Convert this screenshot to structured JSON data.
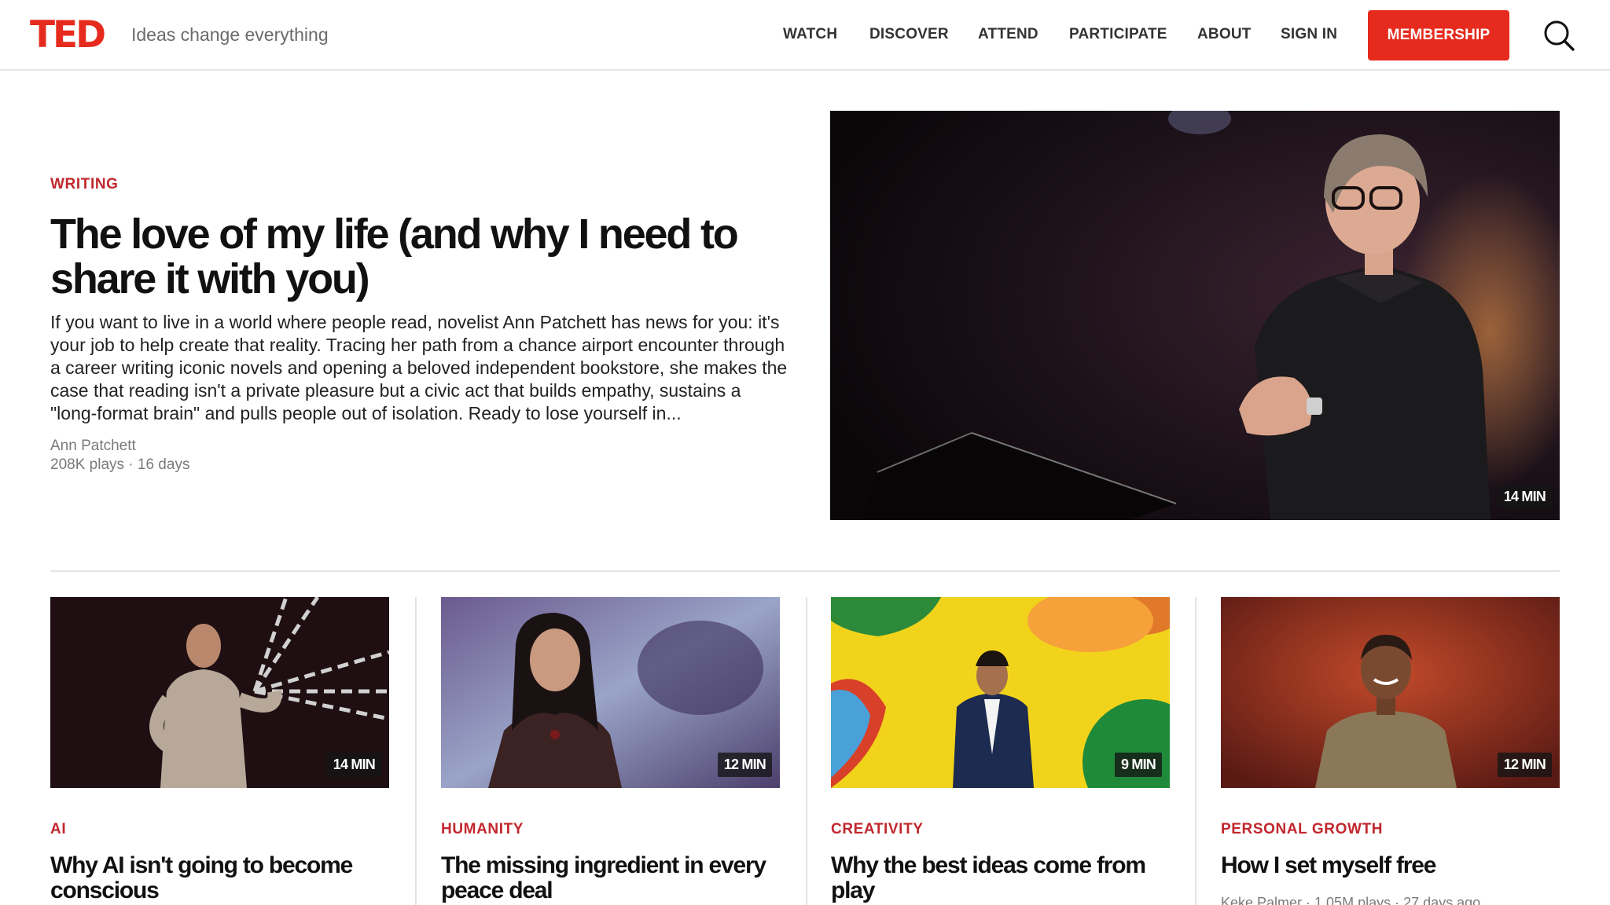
{
  "header": {
    "logo": "TED",
    "tagline": "Ideas change everything",
    "nav": [
      "WATCH",
      "DISCOVER",
      "ATTEND",
      "PARTICIPATE",
      "ABOUT",
      "SIGN IN"
    ],
    "membership_label": "MEMBERSHIP",
    "search_icon": "search-icon"
  },
  "hero": {
    "topic": "WRITING",
    "title": "The love of my life (and why I need to share it with you)",
    "description": "If you want to live in a world where people read, novelist Ann Patchett has news for you: it's your job to help create that reality. Tracing her path from a chance airport encounter through a career writing iconic novels and opening a beloved independent bookstore, she makes the case that reading isn't a private pleasure but a civic act that builds empathy, sustains a \"long-format brain\" and pulls people out of isolation. Ready to lose yourself in...",
    "speaker": "Ann Patchett",
    "meta": "208K plays · 16 days",
    "duration": "14 MIN"
  },
  "cards": [
    {
      "topic": "AI",
      "title": "Why AI isn't going to become conscious",
      "duration": "14 MIN",
      "meta": ""
    },
    {
      "topic": "HUMANITY",
      "title": "The missing ingredient in every peace deal",
      "duration": "12 MIN",
      "meta": ""
    },
    {
      "topic": "CREATIVITY",
      "title": "Why the best ideas come from play",
      "duration": "9 MIN",
      "meta": ""
    },
    {
      "topic": "PERSONAL GROWTH",
      "title": "How I set myself free",
      "duration": "12 MIN",
      "meta": "Keke Palmer · 1.05M plays · 27 days ago"
    }
  ],
  "colors": {
    "accent": "#e62b1e",
    "topic": "#c1272d"
  }
}
